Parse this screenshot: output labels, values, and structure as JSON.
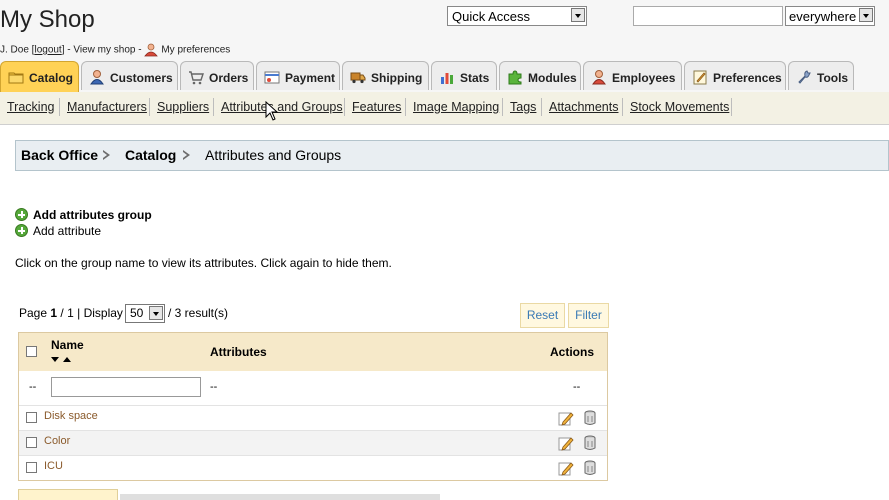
{
  "header": {
    "shop_title": "My Shop",
    "user_name": "J. Doe [",
    "logout_label": "logout",
    "user_suffix": "] - View my shop -",
    "preferences_label": "My preferences",
    "quick_access": "Quick Access",
    "search_value": "",
    "search_scope": "everywhere"
  },
  "tabs": [
    {
      "label": "Catalog",
      "icon": "catalog-folder-icon",
      "active": true
    },
    {
      "label": "Customers",
      "icon": "customers-icon"
    },
    {
      "label": "Orders",
      "icon": "cart-icon"
    },
    {
      "label": "Payment",
      "icon": "payment-icon"
    },
    {
      "label": "Shipping",
      "icon": "truck-icon"
    },
    {
      "label": "Stats",
      "icon": "stats-icon"
    },
    {
      "label": "Modules",
      "icon": "puzzle-icon"
    },
    {
      "label": "Employees",
      "icon": "employee-icon"
    },
    {
      "label": "Preferences",
      "icon": "preferences-icon"
    },
    {
      "label": "Tools",
      "icon": "wrench-icon"
    }
  ],
  "subnav": [
    "Tracking",
    "Manufacturers",
    "Suppliers",
    "Attributes and Groups",
    "Features",
    "Image Mapping",
    "Tags",
    "Attachments",
    "Stock Movements"
  ],
  "breadcrumb": {
    "root": "Back Office",
    "section": "Catalog",
    "current": "Attributes and Groups"
  },
  "actions": {
    "add_group": "Add attributes group",
    "add_attribute": "Add attribute"
  },
  "info": "Click on the group name to view its attributes. Click again to hide them.",
  "pagination": {
    "page_label": "Page",
    "page_current": "1",
    "page_total": "1",
    "display_label": "| Display",
    "display_value": "50",
    "results": "/ 3 result(s)",
    "reset_label": "Reset",
    "filter_label": "Filter"
  },
  "table": {
    "headers": {
      "name": "Name",
      "attributes": "Attributes",
      "actions": "Actions"
    },
    "filter_placeholder_left": "--",
    "filter_placeholder_attr": "--",
    "filter_placeholder_actions": "--",
    "rows": [
      {
        "name": "Disk space"
      },
      {
        "name": "Color"
      },
      {
        "name": "ICU"
      }
    ]
  },
  "colors": {
    "active_tab": "#ffd256",
    "subnav_bg": "#f3f1e4",
    "breadcrumb_bg": "#e9eef2",
    "table_header_bg": "#f6e9c9",
    "link_brown": "#8a5a2b"
  }
}
